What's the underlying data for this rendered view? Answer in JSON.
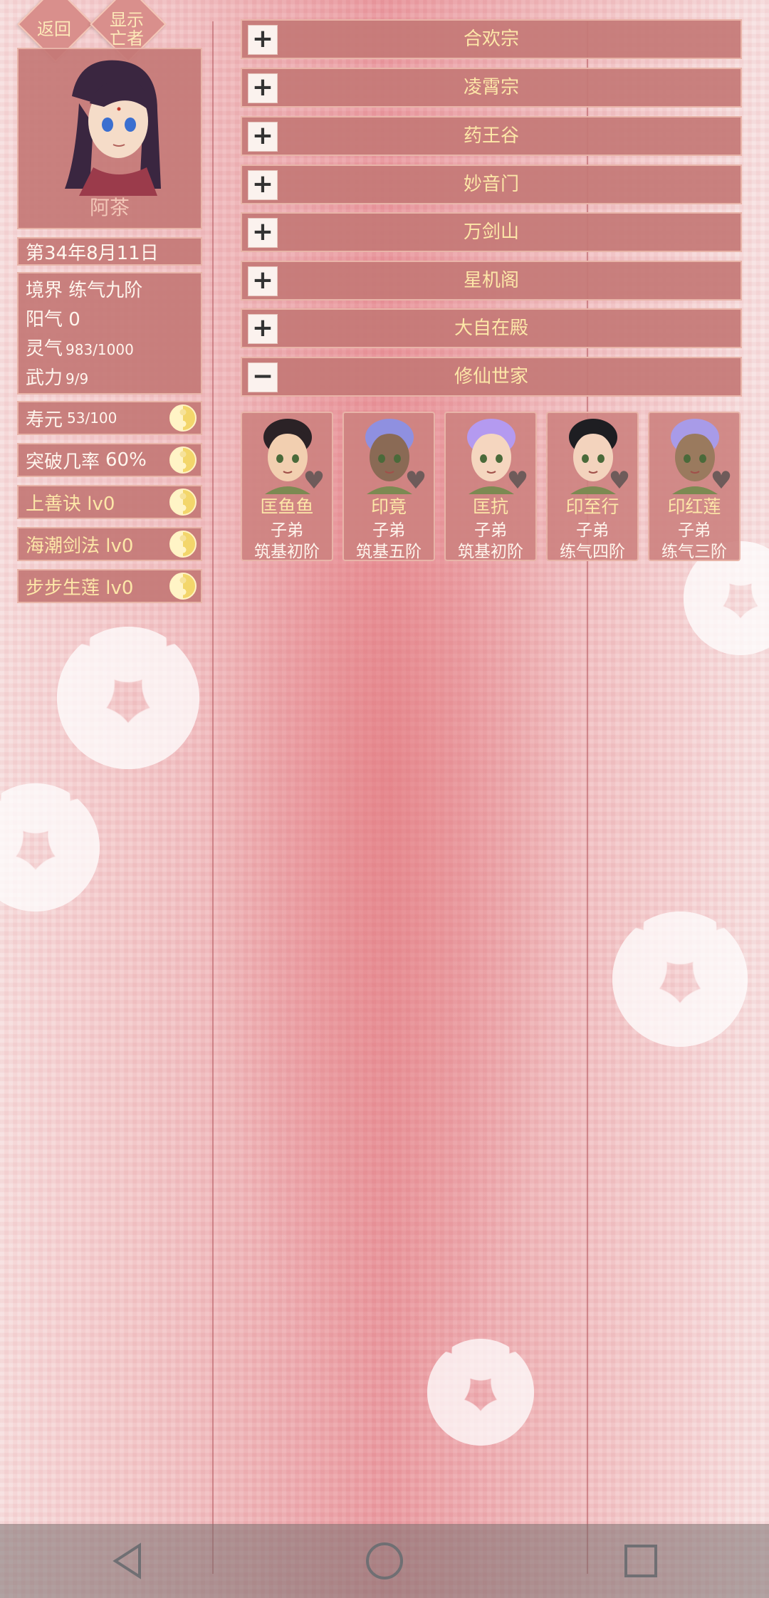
{
  "top_buttons": {
    "back": "返回",
    "show_dead_line1": "显示",
    "show_dead_line2": "亡者"
  },
  "character": {
    "name": "阿茶",
    "date": "第34年8月11日",
    "realm_label": "境界",
    "realm_value": "练气九阶",
    "yang_label": "阳气",
    "yang_value": "0",
    "spirit_label": "灵气",
    "spirit_value": "983/1000",
    "force_label": "武力",
    "force_value": "9/9"
  },
  "attributes": [
    {
      "label": "寿元",
      "value": "53/100"
    },
    {
      "label": "突破几率",
      "value": "60%"
    }
  ],
  "skills": [
    {
      "label": "上善诀 lv0"
    },
    {
      "label": "海潮剑法 lv0"
    },
    {
      "label": "步步生莲 lv0"
    }
  ],
  "sects": [
    {
      "toggle": "+",
      "name": "合欢宗"
    },
    {
      "toggle": "+",
      "name": "凌霄宗"
    },
    {
      "toggle": "+",
      "name": "药王谷"
    },
    {
      "toggle": "+",
      "name": "妙音门"
    },
    {
      "toggle": "+",
      "name": "万剑山"
    },
    {
      "toggle": "+",
      "name": "星机阁"
    },
    {
      "toggle": "+",
      "name": "大自在殿"
    },
    {
      "toggle": "−",
      "name": "修仙世家"
    }
  ],
  "members": [
    {
      "name": "匡鱼鱼",
      "role": "子弟",
      "level": "筑基初阶",
      "hair": "#2b2226",
      "skin": "#f2cfb0"
    },
    {
      "name": "印竟",
      "role": "子弟",
      "level": "筑基五阶",
      "hair": "#8f90e0",
      "skin": "#8a6a55"
    },
    {
      "name": "匡抗",
      "role": "子弟",
      "level": "筑基初阶",
      "hair": "#b49af0",
      "skin": "#f5d6bf"
    },
    {
      "name": "印至行",
      "role": "子弟",
      "level": "练气四阶",
      "hair": "#1e1e22",
      "skin": "#f3d3bd"
    },
    {
      "name": "印红莲",
      "role": "子弟",
      "level": "练气三阶",
      "hair": "#a89be8",
      "skin": "#9a7a5e"
    }
  ],
  "icons": {
    "heart": "heart-icon",
    "taiji": "yin-yang-icon",
    "back": "nav-back-icon",
    "home": "nav-home-icon",
    "recent": "nav-recent-icon"
  }
}
